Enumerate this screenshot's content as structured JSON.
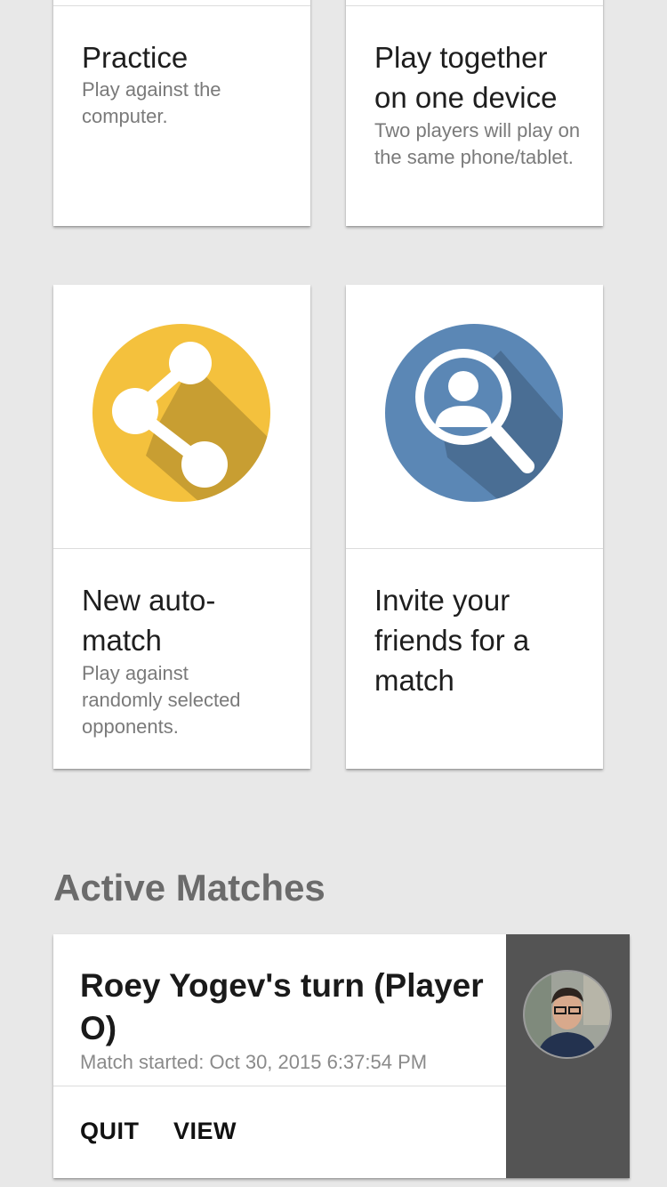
{
  "options": [
    {
      "title": "Practice",
      "subtitle": "Play against the computer."
    },
    {
      "title": "Play together on one device",
      "subtitle": "Two players will play on the same phone/tablet."
    },
    {
      "title": "New auto-match",
      "subtitle": "Play against randomly selected opponents.",
      "icon": "share-icon",
      "icon_color": "#f4c13d"
    },
    {
      "title": "Invite your friends for a match",
      "icon": "person-search-icon",
      "icon_color": "#5b87b5"
    }
  ],
  "active_matches": {
    "section_title": "Active Matches",
    "items": [
      {
        "title": "Roey Yogev's turn (Player O)",
        "meta": "Match started: Oct 30, 2015 6:37:54 PM",
        "quit_label": "QUIT",
        "view_label": "VIEW",
        "side_color": "#545454"
      }
    ]
  }
}
